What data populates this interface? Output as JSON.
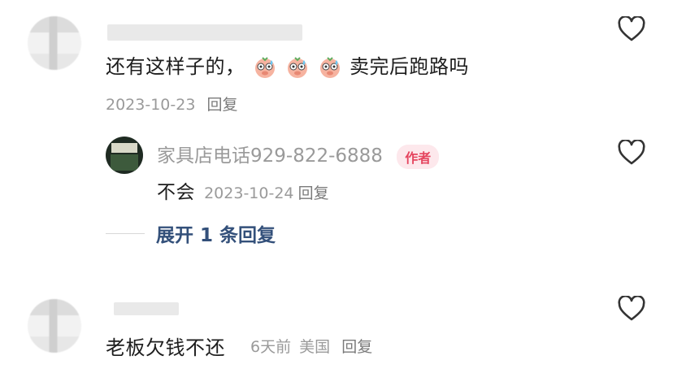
{
  "comments": [
    {
      "text_before": "还有这样子的，",
      "text_after": "卖完后跑路吗",
      "emojis": [
        "sweat-pig-emoji",
        "sweat-pig-emoji",
        "sweat-pig-emoji"
      ],
      "date": "2023-10-23",
      "reply_label": "回复"
    },
    {
      "text": "老板欠钱不还",
      "date": "6天前",
      "location": "美国",
      "reply_label": "回复"
    }
  ],
  "author_reply": {
    "name": "家具店电话929-822-6888",
    "tag": "作者",
    "text": "不会",
    "date": "2023-10-24",
    "reply_label": "回复"
  },
  "expand": {
    "label": "展开 1 条回复"
  },
  "icons": {
    "like": "heart-outline-icon"
  },
  "colors": {
    "author_tag_bg": "#fde8ec",
    "author_tag_text": "#e5455f",
    "expand_text": "#33507a"
  }
}
